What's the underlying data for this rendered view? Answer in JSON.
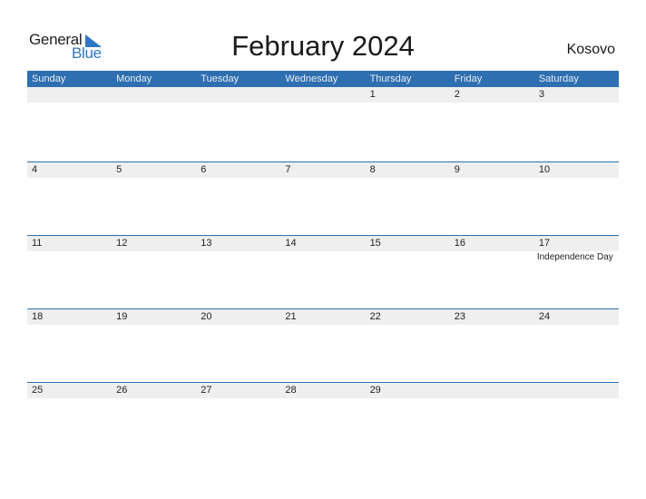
{
  "logo": {
    "general": "General",
    "blue": "Blue",
    "accent": "#2f77c6"
  },
  "title": "February 2024",
  "country": "Kosovo",
  "colors": {
    "header_bg": "#2e6fb0",
    "date_strip": "#efefef"
  },
  "weekdays": [
    "Sunday",
    "Monday",
    "Tuesday",
    "Wednesday",
    "Thursday",
    "Friday",
    "Saturday"
  ],
  "weeks": [
    [
      {
        "day": ""
      },
      {
        "day": ""
      },
      {
        "day": ""
      },
      {
        "day": ""
      },
      {
        "day": "1"
      },
      {
        "day": "2"
      },
      {
        "day": "3"
      }
    ],
    [
      {
        "day": "4"
      },
      {
        "day": "5"
      },
      {
        "day": "6"
      },
      {
        "day": "7"
      },
      {
        "day": "8"
      },
      {
        "day": "9"
      },
      {
        "day": "10"
      }
    ],
    [
      {
        "day": "11"
      },
      {
        "day": "12"
      },
      {
        "day": "13"
      },
      {
        "day": "14"
      },
      {
        "day": "15"
      },
      {
        "day": "16"
      },
      {
        "day": "17",
        "event": "Independence Day"
      }
    ],
    [
      {
        "day": "18"
      },
      {
        "day": "19"
      },
      {
        "day": "20"
      },
      {
        "day": "21"
      },
      {
        "day": "22"
      },
      {
        "day": "23"
      },
      {
        "day": "24"
      }
    ],
    [
      {
        "day": "25"
      },
      {
        "day": "26"
      },
      {
        "day": "27"
      },
      {
        "day": "28"
      },
      {
        "day": "29"
      },
      {
        "day": ""
      },
      {
        "day": ""
      }
    ]
  ]
}
